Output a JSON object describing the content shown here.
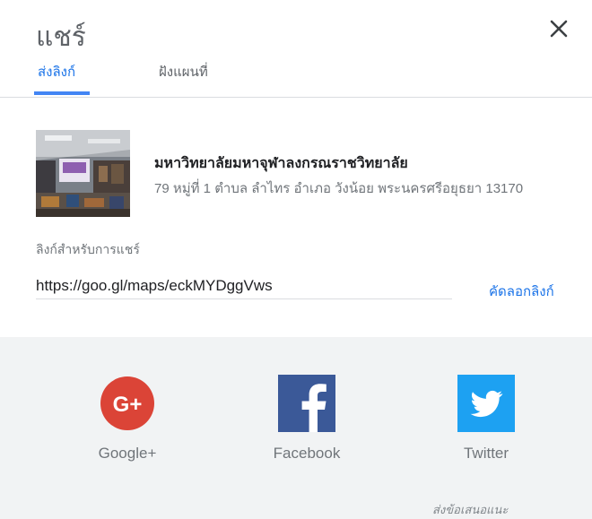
{
  "dialog": {
    "title": "แชร์",
    "close_icon": "close-icon"
  },
  "tabs": [
    {
      "label": "ส่งลิงก์",
      "active": true
    },
    {
      "label": "ฝังแผนที่",
      "active": false
    }
  ],
  "place": {
    "name": "มหาวิทยาลัยมหาจุฬาลงกรณราชวิทยาลัย",
    "address": "79 หมู่ที่ 1 ตำบล ลำไทร อำเภอ วังน้อย พระนครศรีอยุธยา 13170"
  },
  "share_link": {
    "label": "ลิงก์สำหรับการแชร์",
    "url": "https://goo.gl/maps/eckMYDggVws",
    "copy_label": "คัดลอกลิงก์"
  },
  "social": [
    {
      "name": "Google+",
      "icon": "google-plus-icon",
      "color": "#db4437"
    },
    {
      "name": "Facebook",
      "icon": "facebook-icon",
      "color": "#3b5998"
    },
    {
      "name": "Twitter",
      "icon": "twitter-icon",
      "color": "#1da1f2"
    }
  ],
  "feedback_label": "ส่งข้อเสนอแนะ",
  "colors": {
    "accent": "#1a73e8",
    "panel_bg": "#f1f3f4"
  }
}
